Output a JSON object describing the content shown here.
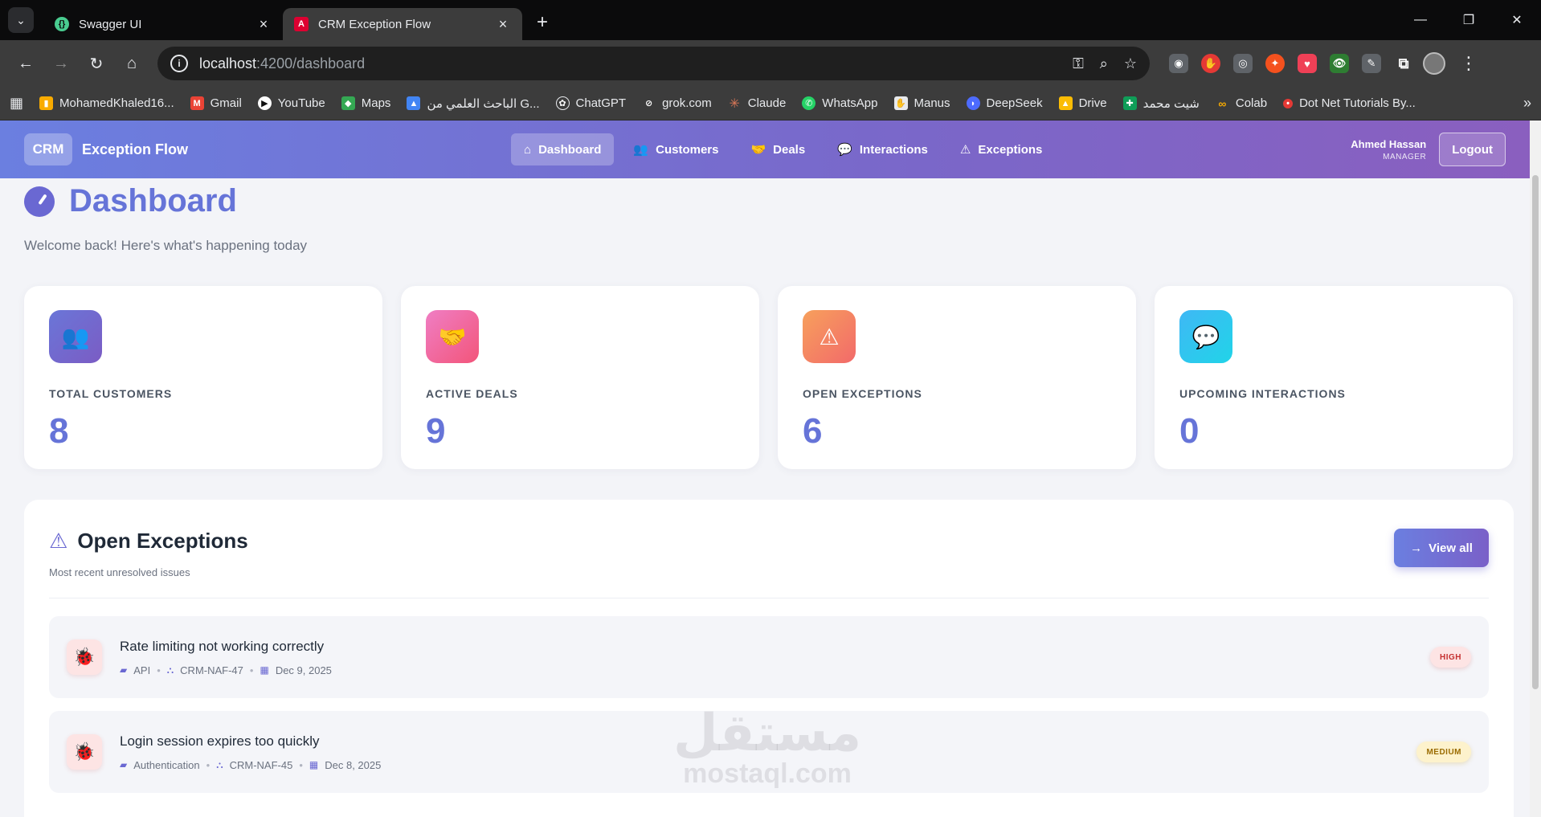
{
  "browser": {
    "tabs": [
      {
        "title": "Swagger UI",
        "active": false,
        "favicon": "swagger-icon",
        "color": "#49cc90"
      },
      {
        "title": "CRM Exception Flow",
        "active": true,
        "favicon": "angular-icon",
        "color": "#dd0031"
      }
    ],
    "url_host": "localhost",
    "url_path": ":4200/dashboard",
    "bookmarks": [
      {
        "label": "MohamedKhaled16...",
        "icon": "analytics-icon",
        "color": "#f9ab00"
      },
      {
        "label": "Gmail",
        "icon": "gmail-icon",
        "color": "#ea4335"
      },
      {
        "label": "YouTube",
        "icon": "youtube-icon",
        "color": "#ffffff"
      },
      {
        "label": "Maps",
        "icon": "maps-icon",
        "color": "#34a853"
      },
      {
        "label": "الباحث العلمي من G...",
        "icon": "scholar-icon",
        "color": "#4285f4"
      },
      {
        "label": "ChatGPT",
        "icon": "chatgpt-icon",
        "color": "#ffffff"
      },
      {
        "label": "grok.com",
        "icon": "grok-icon",
        "color": "#ffffff"
      },
      {
        "label": "Claude",
        "icon": "claude-icon",
        "color": "#d97757"
      },
      {
        "label": "WhatsApp",
        "icon": "whatsapp-icon",
        "color": "#25d366"
      },
      {
        "label": "Manus",
        "icon": "manus-icon",
        "color": "#ffffff"
      },
      {
        "label": "DeepSeek",
        "icon": "deepseek-icon",
        "color": "#4d6bfe"
      },
      {
        "label": "Drive",
        "icon": "drive-icon",
        "color": "#fbbc04"
      },
      {
        "label": "شيت محمد",
        "icon": "sheets-icon",
        "color": "#0f9d58"
      },
      {
        "label": "Colab",
        "icon": "colab-icon",
        "color": "#f9ab00"
      },
      {
        "label": "Dot Net Tutorials By...",
        "icon": "dotnet-icon",
        "color": "#e53935"
      }
    ]
  },
  "app": {
    "logo": "CRM",
    "name": "Exception Flow",
    "nav": [
      {
        "label": "Dashboard",
        "icon": "home-icon",
        "glyph": "⌂",
        "active": true
      },
      {
        "label": "Customers",
        "icon": "users-icon",
        "glyph": "👥",
        "active": false
      },
      {
        "label": "Deals",
        "icon": "handshake-icon",
        "glyph": "🤝",
        "active": false
      },
      {
        "label": "Interactions",
        "icon": "chat-icon",
        "glyph": "💬",
        "active": false
      },
      {
        "label": "Exceptions",
        "icon": "warning-icon",
        "glyph": "⚠",
        "active": false
      }
    ],
    "user": {
      "name": "Ahmed Hassan",
      "role": "MANAGER"
    },
    "logout_label": "Logout"
  },
  "dashboard": {
    "title": "Dashboard",
    "welcome": "Welcome back! Here's what's happening today",
    "stats": [
      {
        "label": "TOTAL CUSTOMERS",
        "value": "8",
        "icon": "users-icon",
        "glyph": "👥",
        "gradient": [
          "#6a76d8",
          "#7b5cc4"
        ]
      },
      {
        "label": "ACTIVE DEALS",
        "value": "9",
        "icon": "handshake-icon",
        "glyph": "🤝",
        "gradient": [
          "#f07ec4",
          "#f2557a"
        ]
      },
      {
        "label": "OPEN EXCEPTIONS",
        "value": "6",
        "icon": "warning-icon",
        "glyph": "⚠",
        "gradient": [
          "#f7a05c",
          "#f26a6a"
        ]
      },
      {
        "label": "UPCOMING INTERACTIONS",
        "value": "0",
        "icon": "chat-icon",
        "glyph": "💬",
        "gradient": [
          "#3fb8f5",
          "#21d4e8"
        ]
      }
    ],
    "exceptions_panel": {
      "title": "Open Exceptions",
      "subtitle": "Most recent unresolved issues",
      "view_all_label": "View all",
      "items": [
        {
          "title": "Rate limiting not working correctly",
          "category": "API",
          "ticket": "CRM-NAF-47",
          "date": "Dec 9, 2025",
          "severity": "HIGH"
        },
        {
          "title": "Login session expires too quickly",
          "category": "Authentication",
          "ticket": "CRM-NAF-45",
          "date": "Dec 8, 2025",
          "severity": "MEDIUM"
        }
      ]
    }
  },
  "watermark": {
    "arabic": "مستقل",
    "latin": "mostaql.com"
  }
}
